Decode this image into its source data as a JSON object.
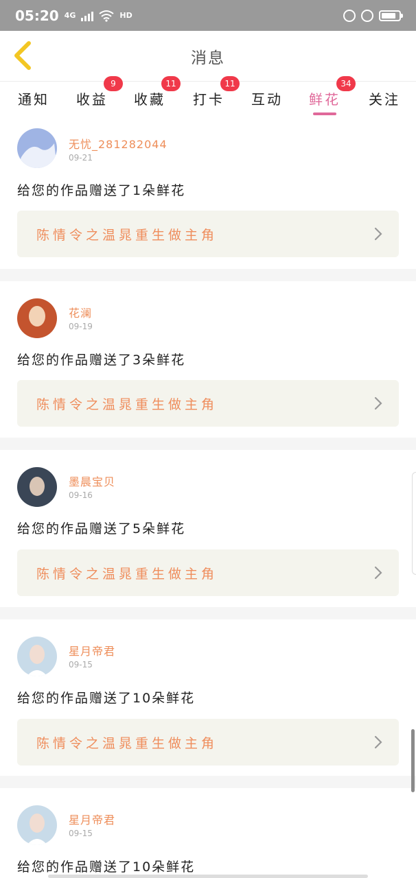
{
  "status_bar": {
    "time": "05:20",
    "signal": "4G",
    "hd": "HD"
  },
  "header": {
    "title": "消息"
  },
  "tabs": [
    {
      "label": "通知",
      "badge": ""
    },
    {
      "label": "收益",
      "badge": "9"
    },
    {
      "label": "收藏",
      "badge": "11"
    },
    {
      "label": "打卡",
      "badge": "11"
    },
    {
      "label": "互动",
      "badge": ""
    },
    {
      "label": "鲜花",
      "badge": "34",
      "active": true
    },
    {
      "label": "关注",
      "badge": ""
    }
  ],
  "messages": [
    {
      "user": "无忧_281282044",
      "date": "09-21",
      "text": "给您的作品赠送了1朵鲜花",
      "work": "陈情令之温晁重生做主角",
      "avatar_colors": [
        "#9fb4e4",
        "#ffffff"
      ]
    },
    {
      "user": "花澜",
      "date": "09-19",
      "text": "给您的作品赠送了3朵鲜花",
      "work": "陈情令之温晁重生做主角",
      "avatar_colors": [
        "#c4542e",
        "#f3d3b6"
      ]
    },
    {
      "user": "墨晨宝贝",
      "date": "09-16",
      "text": "给您的作品赠送了5朵鲜花",
      "work": "陈情令之温晁重生做主角",
      "avatar_colors": [
        "#3a4656",
        "#d9c5b5"
      ]
    },
    {
      "user": "星月帝君",
      "date": "09-15",
      "text": "给您的作品赠送了10朵鲜花",
      "work": "陈情令之温晁重生做主角",
      "avatar_colors": [
        "#c8dbe9",
        "#f1ddd2"
      ]
    },
    {
      "user": "星月帝君",
      "date": "09-15",
      "text": "给您的作品赠送了10朵鲜花",
      "work": "",
      "avatar_colors": [
        "#c8dbe9",
        "#f1ddd2"
      ]
    }
  ],
  "colors": {
    "accent": "#e0699a",
    "badge": "#f0394a",
    "username": "#ee8e5a",
    "work_title": "#ef8d5c",
    "back_arrow": "#f3c623"
  }
}
